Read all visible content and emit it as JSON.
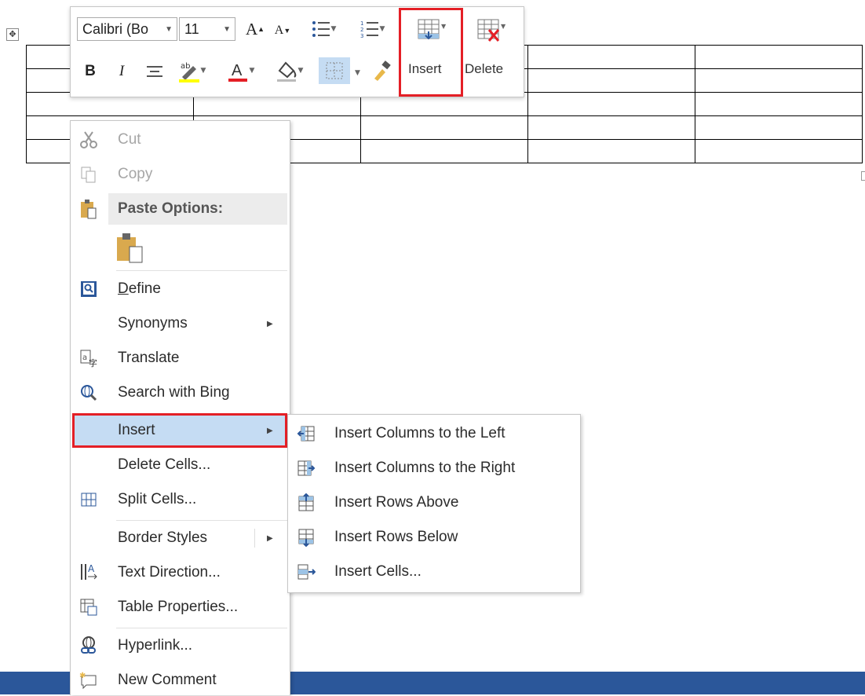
{
  "toolbar": {
    "font_name": "Calibri (Bo",
    "font_size": "11",
    "insert_label": "Insert",
    "delete_label": "Delete",
    "highlight_color": "#ffff00",
    "font_color": "#e41f26",
    "accent_red": "#e41f26"
  },
  "context_menu": {
    "cut": "Cut",
    "copy": "Copy",
    "paste_options": "Paste Options:",
    "define": "Define",
    "synonyms": "Synonyms",
    "translate": "Translate",
    "search_bing": "Search with Bing",
    "insert": "Insert",
    "delete_cells": "Delete Cells...",
    "split_cells": "Split Cells...",
    "border_styles": "Border Styles",
    "text_direction": "Text Direction...",
    "table_properties": "Table Properties...",
    "hyperlink": "Hyperlink...",
    "new_comment": "New Comment"
  },
  "insert_submenu": {
    "cols_left": "Insert Columns to the Left",
    "cols_right": "Insert Columns to the Right",
    "rows_above": "Insert Rows Above",
    "rows_below": "Insert Rows Below",
    "cells": "Insert Cells..."
  },
  "status_bar_color": "#2b579a"
}
